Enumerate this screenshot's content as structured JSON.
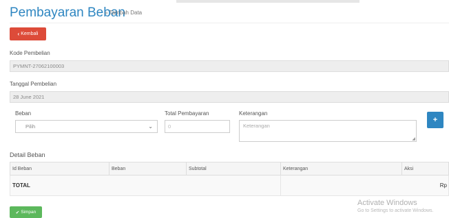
{
  "header": {
    "title": "Pembayaran Beban",
    "subtitle": "» Tambah Data"
  },
  "buttons": {
    "back_icon": "chevron-left-icon",
    "back_label": "Kembali",
    "add_label": "+",
    "save_icon": "check-icon",
    "save_label": "Simpan"
  },
  "form": {
    "kode_label": "Kode Pembelian",
    "kode_value": "PYMNT-27062100003",
    "tanggal_label": "Tanggal Pembelian",
    "tanggal_value": "28 June 2021",
    "beban_label": "Beban",
    "beban_selected": "Pilih",
    "total_label": "Total Pembayaran",
    "total_placeholder": "0",
    "keterangan_label": "Keterangan",
    "keterangan_placeholder": "Keterangan"
  },
  "detail": {
    "title": "Detail Beban",
    "columns": [
      "Id Beban",
      "Beban",
      "Subtotal",
      "Keterangan",
      "Aksi"
    ],
    "total_label": "TOTAL",
    "total_value": "Rp"
  },
  "watermark": {
    "title": "Activate Windows",
    "subtitle": "Go to Settings to activate Windows."
  },
  "colors": {
    "primary": "#2e86c1",
    "danger": "#dd4b39",
    "success": "#5cb85c"
  }
}
